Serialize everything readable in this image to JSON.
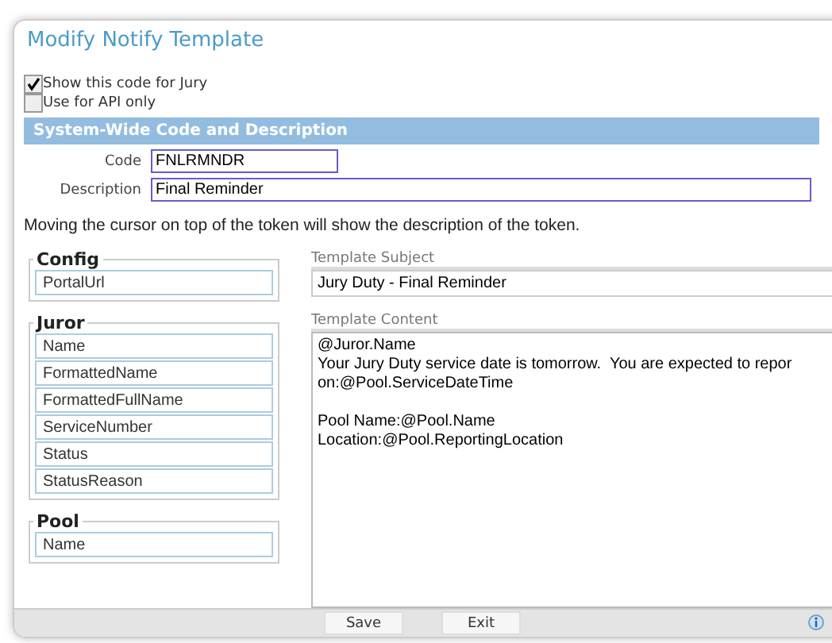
{
  "window": {
    "title": "Modify Notify Template"
  },
  "options": [
    {
      "label": "Show this code for Jury",
      "checked": true
    },
    {
      "label": "Use for API only",
      "checked": false
    }
  ],
  "section": {
    "title": "System-Wide Code and Description"
  },
  "fields": [
    {
      "label": "Code",
      "value": "FNLRMNDR"
    },
    {
      "label": "Description",
      "value": "Final Reminder"
    }
  ],
  "hint": "Moving the cursor on top of the token will show the description of the token.",
  "token_groups": [
    {
      "title": "Config",
      "tokens": [
        "PortalUrl"
      ]
    },
    {
      "title": "Juror",
      "tokens": [
        "Name",
        "FormattedName",
        "FormattedFullName",
        "ServiceNumber",
        "Status",
        "StatusReason"
      ]
    },
    {
      "title": "Pool",
      "tokens": [
        "Name"
      ]
    }
  ],
  "template_subject": {
    "label": "Template Subject",
    "value": "Jury Duty - Final Reminder"
  },
  "template_content": {
    "label": "Template Content",
    "paragraphs": [
      [
        "@Juror.Name",
        "Your Jury Duty service date is tomorrow.  You are expected to repor",
        "on:@Pool.ServiceDateTime"
      ],
      [
        "Pool Name:@Pool.Name",
        "Location:@Pool.ReportingLocation"
      ]
    ]
  },
  "buttons": [
    "Save",
    "Exit"
  ]
}
